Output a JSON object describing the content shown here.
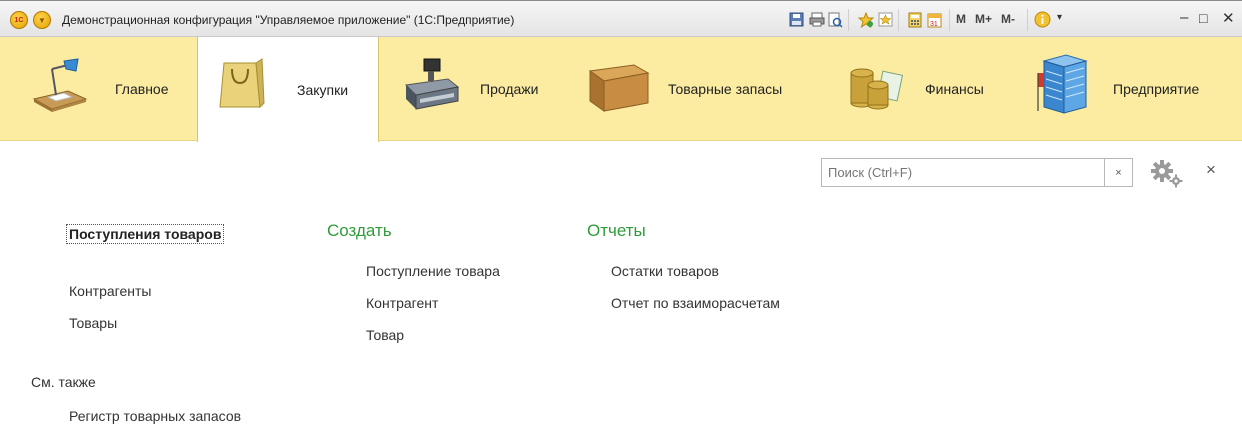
{
  "window": {
    "title": "Демонстрационная конфигурация \"Управляемое приложение\"  (1С:Предприятие)",
    "logo_text": "1С",
    "toolbar_labels": [
      "M",
      "M+",
      "M-"
    ]
  },
  "sections": [
    {
      "label": "Главное",
      "icon": "desk-lamp-icon"
    },
    {
      "label": "Закупки",
      "icon": "shopping-bag-icon",
      "active": true
    },
    {
      "label": "Продажи",
      "icon": "cash-register-icon"
    },
    {
      "label": "Товарные запасы",
      "icon": "cardboard-box-icon"
    },
    {
      "label": "Финансы",
      "icon": "coins-icon"
    },
    {
      "label": "Предприятие",
      "icon": "office-building-icon"
    }
  ],
  "search": {
    "placeholder": "Поиск (Ctrl+F)",
    "clear": "×"
  },
  "close_label": "×",
  "navigation": {
    "main_link": "Поступления товаров",
    "links": [
      "Контрагенты",
      "Товары"
    ]
  },
  "create": {
    "heading": "Создать",
    "items": [
      "Поступление товара",
      "Контрагент",
      "Товар"
    ]
  },
  "reports": {
    "heading": "Отчеты",
    "items": [
      "Остатки товаров",
      "Отчет по взаиморасчетам"
    ]
  },
  "see_also": {
    "heading": "См. также",
    "items": [
      "Регистр товарных запасов"
    ]
  },
  "colors": {
    "section_panel": "#fbeca2",
    "green_heading": "#2f9c3a"
  }
}
